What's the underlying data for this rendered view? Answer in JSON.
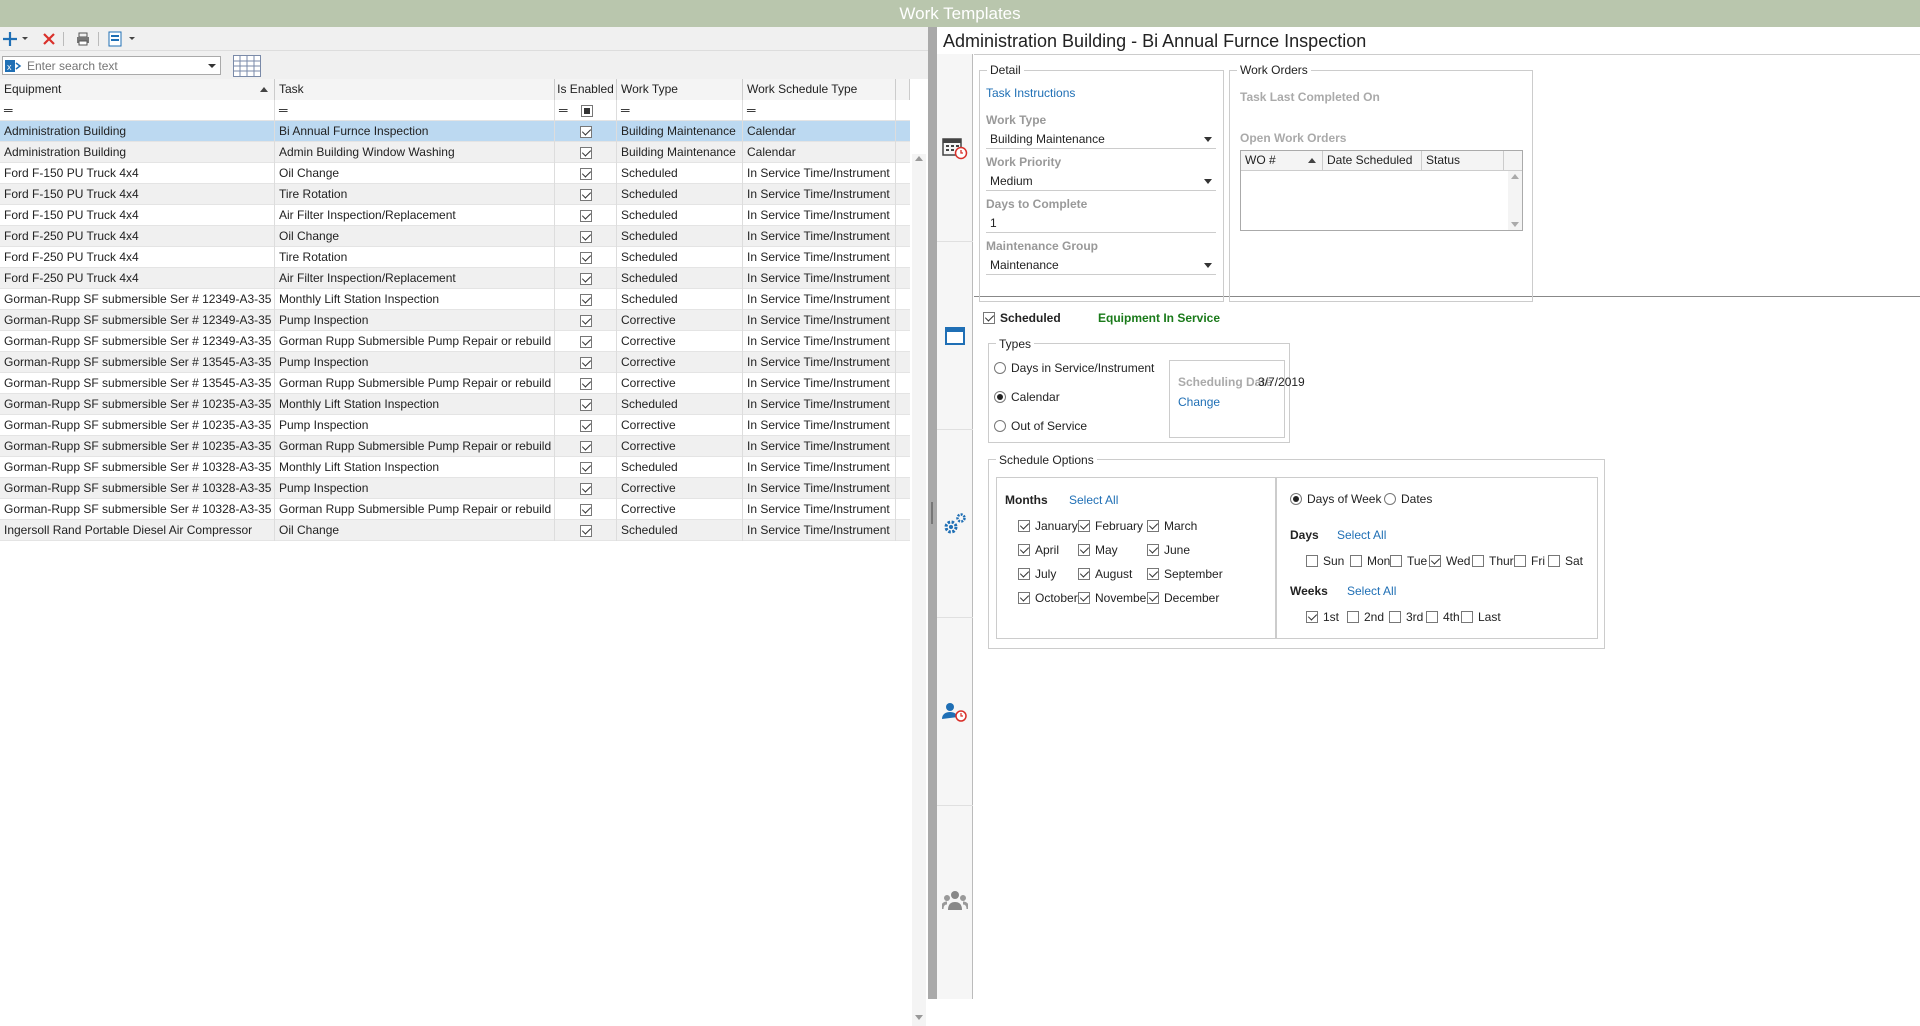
{
  "app": {
    "title": "Work Templates"
  },
  "search": {
    "placeholder": "Enter search text"
  },
  "grid": {
    "columns": [
      "Equipment",
      "Task",
      "Is Enabled",
      "Work Type",
      "Work Schedule Type"
    ],
    "rows": [
      [
        "Administration Building",
        "Bi Annual Furnce Inspection",
        "Building Maintenance",
        "Calendar"
      ],
      [
        "Administration Building",
        "Admin Building Window Washing",
        "Building Maintenance",
        "Calendar"
      ],
      [
        "Ford F-150 PU Truck 4x4",
        "Oil Change",
        "Scheduled",
        "In Service Time/Instrument"
      ],
      [
        "Ford F-150 PU Truck 4x4",
        "Tire Rotation",
        "Scheduled",
        "In Service Time/Instrument"
      ],
      [
        "Ford F-150 PU Truck 4x4",
        "Air Filter Inspection/Replacement",
        "Scheduled",
        "In Service Time/Instrument"
      ],
      [
        "Ford F-250 PU Truck 4x4",
        "Oil Change",
        "Scheduled",
        "In Service Time/Instrument"
      ],
      [
        "Ford F-250 PU Truck 4x4",
        "Tire Rotation",
        "Scheduled",
        "In Service Time/Instrument"
      ],
      [
        "Ford F-250 PU Truck 4x4",
        "Air Filter Inspection/Replacement",
        "Scheduled",
        "In Service Time/Instrument"
      ],
      [
        "Gorman-Rupp SF submersible Ser #  12349-A3-35",
        "Monthly Lift Station Inspection",
        "Scheduled",
        "In Service Time/Instrument"
      ],
      [
        "Gorman-Rupp SF submersible Ser #  12349-A3-35",
        "Pump Inspection",
        "Corrective",
        "In Service Time/Instrument"
      ],
      [
        "Gorman-Rupp SF submersible Ser #  12349-A3-35",
        "Gorman Rupp Submersible Pump Repair or rebuild",
        "Corrective",
        "In Service Time/Instrument"
      ],
      [
        "Gorman-Rupp SF submersible Ser #  13545-A3-35",
        "Pump Inspection",
        "Corrective",
        "In Service Time/Instrument"
      ],
      [
        "Gorman-Rupp SF submersible Ser #  13545-A3-35",
        "Gorman Rupp Submersible Pump Repair or rebuild",
        "Corrective",
        "In Service Time/Instrument"
      ],
      [
        "Gorman-Rupp SF submersible Ser # 10235-A3-35",
        "Monthly Lift Station Inspection",
        "Scheduled",
        "In Service Time/Instrument"
      ],
      [
        "Gorman-Rupp SF submersible Ser # 10235-A3-35",
        "Pump Inspection",
        "Corrective",
        "In Service Time/Instrument"
      ],
      [
        "Gorman-Rupp SF submersible Ser # 10235-A3-35",
        "Gorman Rupp Submersible Pump Repair or rebuild",
        "Corrective",
        "In Service Time/Instrument"
      ],
      [
        "Gorman-Rupp SF submersible Ser # 10328-A3-35",
        "Monthly Lift Station Inspection",
        "Scheduled",
        "In Service Time/Instrument"
      ],
      [
        "Gorman-Rupp SF submersible Ser # 10328-A3-35",
        "Pump Inspection",
        "Corrective",
        "In Service Time/Instrument"
      ],
      [
        "Gorman-Rupp SF submersible Ser # 10328-A3-35",
        "Gorman Rupp Submersible Pump Repair or rebuild",
        "Corrective",
        "In Service Time/Instrument"
      ],
      [
        "Ingersoll Rand Portable Diesel Air Compressor",
        "Oil Change",
        "Scheduled",
        "In Service Time/Instrument"
      ]
    ]
  },
  "detail": {
    "title": "Administration Building - Bi Annual Furnce Inspection",
    "detail_group": "Detail",
    "task_instructions": "Task Instructions",
    "work_type_label": "Work Type",
    "work_type": "Building Maintenance",
    "work_priority_label": "Work Priority",
    "work_priority": "Medium",
    "days_label": "Days to Complete",
    "days": "1",
    "maint_group_label": "Maintenance Group",
    "maint_group": "Maintenance",
    "work_orders_group": "Work Orders",
    "task_last_completed": "Task Last Completed On",
    "open_work_orders": "Open Work Orders",
    "wo_columns": [
      "WO #",
      "Date Scheduled",
      "Status"
    ]
  },
  "schedule": {
    "scheduled_label": "Scheduled",
    "equipment_status": "Equipment In Service",
    "types_group": "Types",
    "type_options": [
      "Days in Service/Instrument",
      "Calendar",
      "Out of Service"
    ],
    "scheduling_date_label": "Scheduling Date",
    "scheduling_date": "3/7/2019",
    "change": "Change",
    "options_group": "Schedule Options",
    "months_label": "Months",
    "select_all": "Select All",
    "months": [
      "January",
      "February",
      "March",
      "April",
      "May",
      "June",
      "July",
      "August",
      "September",
      "October",
      "November",
      "December"
    ],
    "mode_options": [
      "Days of Week",
      "Dates"
    ],
    "days_label": "Days",
    "days": [
      "Sun",
      "Mon",
      "Tue",
      "Wed",
      "Thur",
      "Fri",
      "Sat"
    ],
    "weeks_label": "Weeks",
    "weeks": [
      "1st",
      "2nd",
      "3rd",
      "4th",
      "Last"
    ]
  },
  "colors": {
    "titlebar": "#b9c6ad",
    "accent": "#1f6fb5",
    "status_green": "#1a7a1a",
    "selection": "#bcd9f1"
  },
  "icons": [
    "add-icon",
    "delete-icon",
    "print-icon",
    "export-icon",
    "search-filter-icon",
    "column-chooser-icon",
    "calendar-clock-icon",
    "window-icon",
    "gears-icon",
    "user-clock-icon",
    "users-icon"
  ]
}
